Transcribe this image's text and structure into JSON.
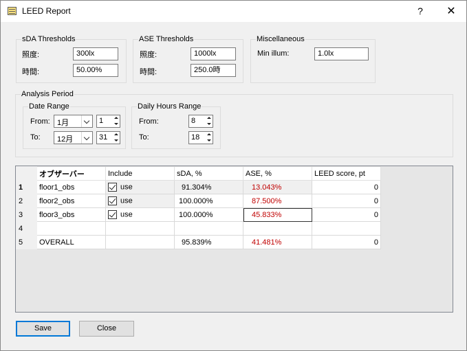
{
  "window": {
    "title": "LEED Report",
    "help_label": "?",
    "close_label": "✕"
  },
  "sda": {
    "legend": "sDA Thresholds",
    "illum_label": "照度:",
    "illum_value": "300lx",
    "time_label": "時間:",
    "time_value": "50.00%"
  },
  "ase": {
    "legend": "ASE Thresholds",
    "illum_label": "照度:",
    "illum_value": "1000lx",
    "time_label": "時間:",
    "time_value": "250.0時"
  },
  "misc": {
    "legend": "Miscellaneous",
    "min_illum_label": "Min illum:",
    "min_illum_value": "1.0lx"
  },
  "analysis": {
    "legend": "Analysis Period",
    "date_range": {
      "legend": "Date Range",
      "from_label": "From:",
      "from_month": "1月",
      "from_day": "1",
      "to_label": "To:",
      "to_month": "12月",
      "to_day": "31"
    },
    "daily_hours": {
      "legend": "Daily Hours Range",
      "from_label": "From:",
      "from_value": "8",
      "to_label": "To:",
      "to_value": "18"
    }
  },
  "grid": {
    "columns": [
      "オブザーバー",
      "Include",
      "sDA, %",
      "ASE, %",
      "LEED score, pt"
    ],
    "rows": [
      {
        "num": "1",
        "observer": "floor1_obs",
        "include": "use",
        "sda": "91.304%",
        "ase": "13.043%",
        "score": "0"
      },
      {
        "num": "2",
        "observer": "floor2_obs",
        "include": "use",
        "sda": "100.000%",
        "ase": "87.500%",
        "score": "0"
      },
      {
        "num": "3",
        "observer": "floor3_obs",
        "include": "use",
        "sda": "100.000%",
        "ase": "45.833%",
        "score": "0"
      },
      {
        "num": "4",
        "observer": "",
        "include": "",
        "sda": "",
        "ase": "",
        "score": ""
      },
      {
        "num": "5",
        "observer": "OVERALL",
        "include": "",
        "sda": "95.839%",
        "ase": "41.481%",
        "score": "0"
      }
    ]
  },
  "buttons": {
    "save": "Save",
    "close": "Close"
  },
  "colors": {
    "ase_value": "#c00000",
    "default_button_border": "#0078d7"
  }
}
